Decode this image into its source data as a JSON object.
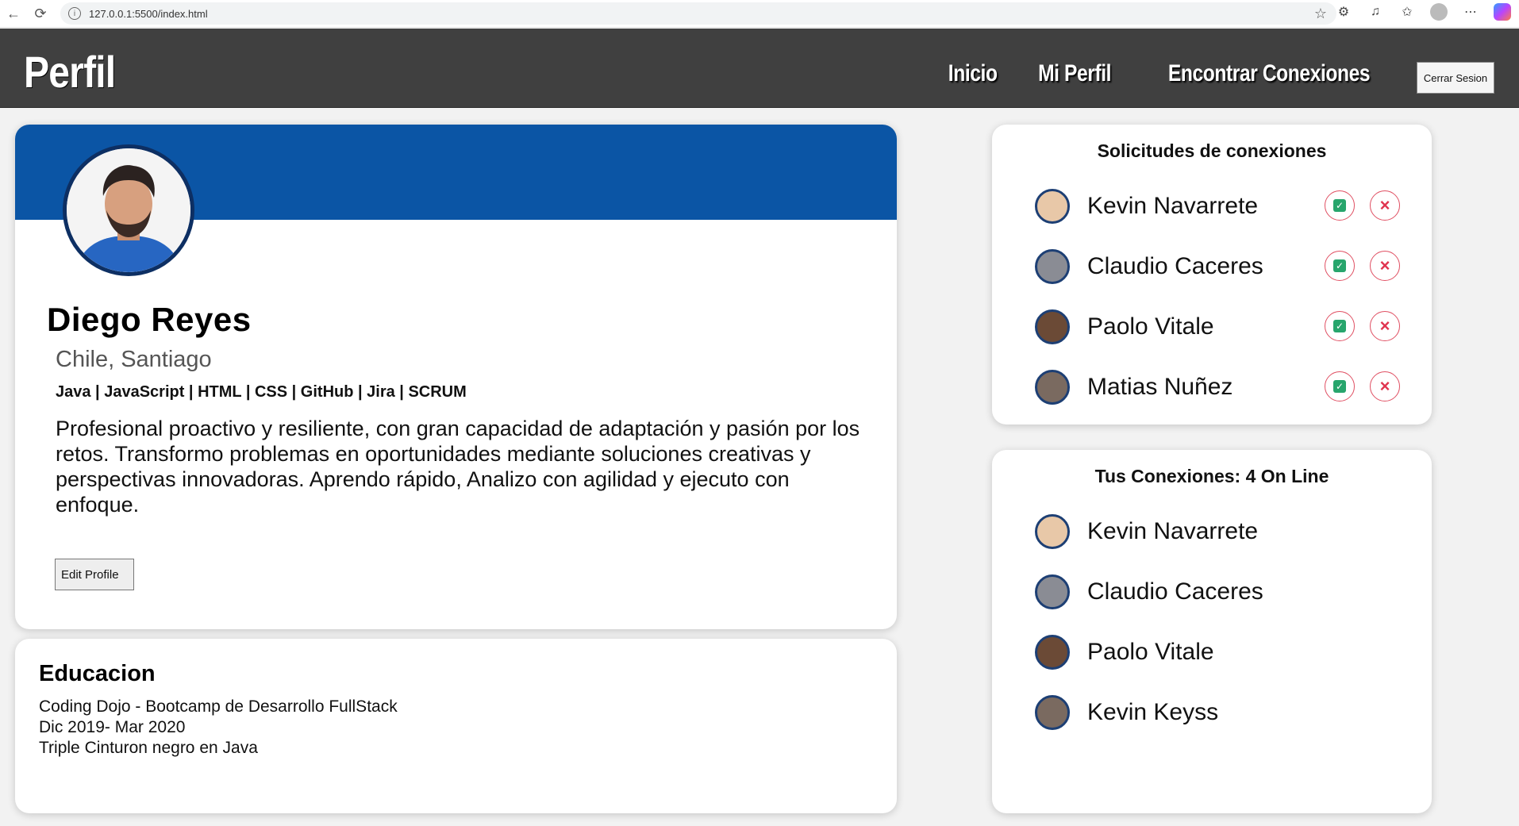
{
  "browser": {
    "url": "127.0.0.1:5500/index.html"
  },
  "header": {
    "brand": "Perfil",
    "nav": [
      "Inicio",
      "Mi Perfil",
      "Encontrar Conexiones"
    ],
    "logout_label": "Cerrar Sesion"
  },
  "profile": {
    "name": "Diego Reyes",
    "location": "Chile, Santiago",
    "skills": "Java | JavaScript | HTML | CSS | GitHub | Jira | SCRUM",
    "bio": "Profesional proactivo y resiliente, con gran capacidad de adaptación y pasión por los retos. Transformo problemas en oportunidades mediante soluciones creativas y perspectivas innovadoras. Aprendo rápido, Analizo con agilidad y ejecuto con enfoque.",
    "edit_label": "Edit Profile",
    "cover_color": "#0b55a5"
  },
  "education": {
    "title": "Educacion",
    "lines": [
      "Coding Dojo - Bootcamp de Desarrollo FullStack",
      "Dic 2019- Mar 2020",
      "Triple Cinturon negro en Java"
    ]
  },
  "requests": {
    "title": "Solicitudes de conexiones",
    "people": [
      "Kevin Navarrete",
      "Claudio Caceres",
      "Paolo Vitale",
      "Matias Nuñez"
    ]
  },
  "connections": {
    "title": "Tus Conexiones: 4 On Line",
    "people": [
      "Kevin Navarrete",
      "Claudio Caceres",
      "Paolo Vitale",
      "Kevin Keyss"
    ]
  }
}
